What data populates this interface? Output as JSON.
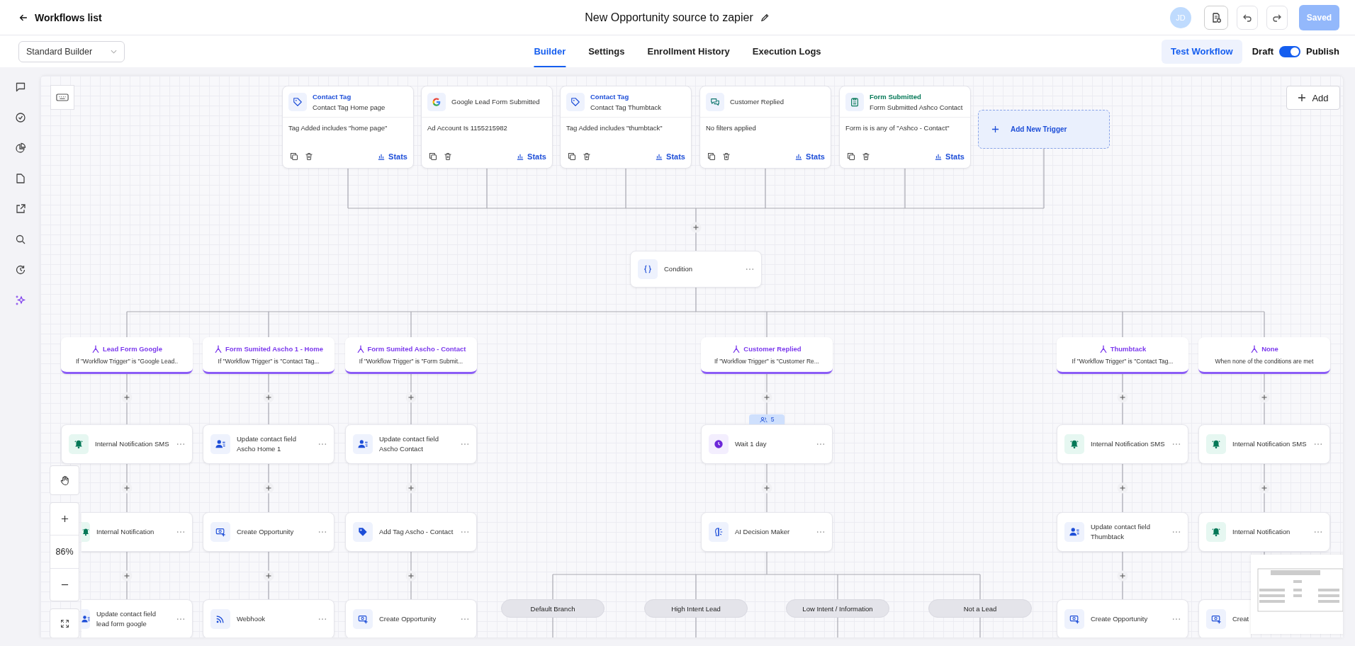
{
  "header": {
    "back_label": "Workflows list",
    "title": "New Opportunity source to zapier",
    "avatar": "JD",
    "save_label": "Saved"
  },
  "toolbar": {
    "builder_mode": "Standard Builder",
    "tabs": [
      {
        "label": "Builder",
        "selected": true
      },
      {
        "label": "Settings",
        "selected": false
      },
      {
        "label": "Enrollment History",
        "selected": false
      },
      {
        "label": "Execution Logs",
        "selected": false
      }
    ],
    "test_label": "Test Workflow",
    "draft_label": "Draft",
    "publish_label": "Publish",
    "published": true
  },
  "canvas": {
    "add_label": "Add",
    "zoom": "86%",
    "add_trigger_label": "Add New Trigger",
    "condition_label": "Condition",
    "triggers": [
      {
        "kind": "contact_tag",
        "title": "Contact Tag",
        "subtitle": "Contact Tag Home page",
        "filter": "Tag Added includes \"home page\"",
        "stats_label": "Stats"
      },
      {
        "kind": "google_form",
        "subtitle": "Google Lead Form Submitted",
        "filter": "Ad Account Is 1155215982",
        "stats_label": "Stats"
      },
      {
        "kind": "contact_tag",
        "title": "Contact Tag",
        "subtitle": "Contact Tag Thumbtack",
        "filter": "Tag Added includes \"thumbtack\"",
        "stats_label": "Stats"
      },
      {
        "kind": "customer_replied",
        "subtitle": "Customer Replied",
        "filter": "No filters applied",
        "stats_label": "Stats"
      },
      {
        "kind": "form_submitted",
        "title": "Form Submitted",
        "subtitle": "Form Submitted Ashco Contact",
        "filter": "Form is is any of \"Ashco - Contact\"",
        "stats_label": "Stats"
      }
    ],
    "branches": [
      {
        "title": "Lead Form Google",
        "condition": "If \"Workflow Trigger\" is \"Google Lead..",
        "steps": [
          {
            "kind": "notification",
            "label": "Internal Notification SMS"
          },
          {
            "kind": "notification",
            "label": "Internal Notification"
          },
          {
            "kind": "update_contact",
            "label": "Update contact field lead form google"
          }
        ]
      },
      {
        "title": "Form Sumited Ascho 1 - Home",
        "condition": "If \"Workflow Trigger\" is \"Contact Tag...",
        "steps": [
          {
            "kind": "update_contact",
            "label": "Update contact field Ascho Home 1"
          },
          {
            "kind": "create_opportunity",
            "label": "Create Opportunity"
          },
          {
            "kind": "webhook",
            "label": "Webhook"
          }
        ]
      },
      {
        "title": "Form Sumited Ascho - Contact",
        "condition": "If \"Workflow Trigger\" is \"Form Submit...",
        "steps": [
          {
            "kind": "update_contact",
            "label": "Update contact field Ascho Contact"
          },
          {
            "kind": "add_tag",
            "label": "Add Tag Ascho - Contact"
          },
          {
            "kind": "create_opportunity",
            "label": "Create Opportunity"
          }
        ]
      },
      {
        "title": "Customer Replied",
        "condition": "If \"Workflow Trigger\" is \"Customer Re...",
        "steps": [
          {
            "kind": "wait",
            "label": "Wait 1 day",
            "contacts": "5"
          },
          {
            "kind": "ai_decision",
            "label": "AI Decision Maker"
          }
        ],
        "outcomes": [
          "Default Branch",
          "High Intent Lead",
          "Low Intent / Information",
          "Not a Lead"
        ]
      },
      {
        "title": "Thumbtack",
        "condition": "If \"Workflow Trigger\" is \"Contact Tag...",
        "steps": [
          {
            "kind": "notification",
            "label": "Internal Notification SMS"
          },
          {
            "kind": "update_contact",
            "label": "Update contact field Thumbtack"
          },
          {
            "kind": "create_opportunity",
            "label": "Create Opportunity"
          }
        ]
      },
      {
        "title": "None",
        "condition": "When none of the conditions are met",
        "steps": [
          {
            "kind": "notification",
            "label": "Internal Notification SMS"
          },
          {
            "kind": "notification",
            "label": "Internal Notification"
          },
          {
            "kind": "create_opportunity",
            "label": "Creat"
          }
        ]
      }
    ]
  }
}
